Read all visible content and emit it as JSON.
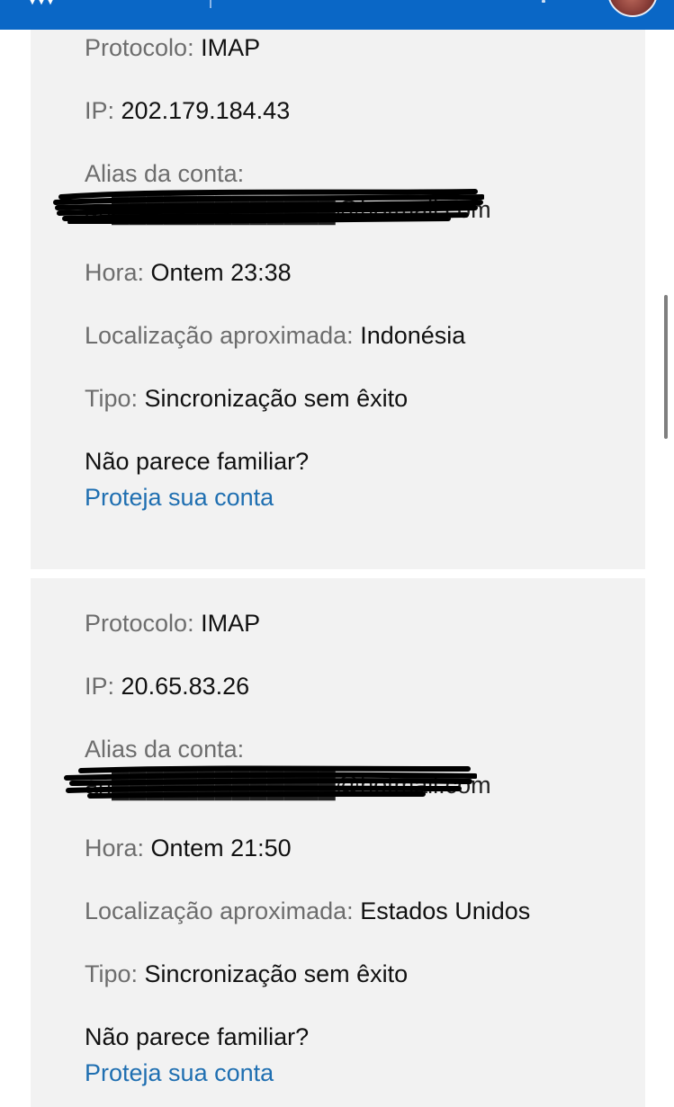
{
  "cards": [
    {
      "protocol_label": "Protocolo:",
      "protocol_value": "IMAP",
      "ip_label": "IP:",
      "ip_value": "202.179.184.43",
      "alias_label": "Alias da conta:",
      "alias_value": "an█████████████@hotmail.com",
      "time_label": "Hora:",
      "time_value": "Ontem 23:38",
      "location_label": "Localização aproximada:",
      "location_value": "Indonésia",
      "type_label": "Tipo:",
      "type_value": "Sincronização sem êxito",
      "question": "Não parece familiar?",
      "link": "Proteja sua conta"
    },
    {
      "protocol_label": "Protocolo:",
      "protocol_value": "IMAP",
      "ip_label": "IP:",
      "ip_value": "20.65.83.26",
      "alias_label": "Alias da conta:",
      "alias_value": "an█████████████@hotmail.com",
      "time_label": "Hora:",
      "time_value": "Ontem 21:50",
      "location_label": "Localização aproximada:",
      "location_value": "Estados Unidos",
      "type_label": "Tipo:",
      "type_value": "Sincronização sem êxito",
      "question": "Não parece familiar?",
      "link": "Proteja sua conta"
    }
  ]
}
